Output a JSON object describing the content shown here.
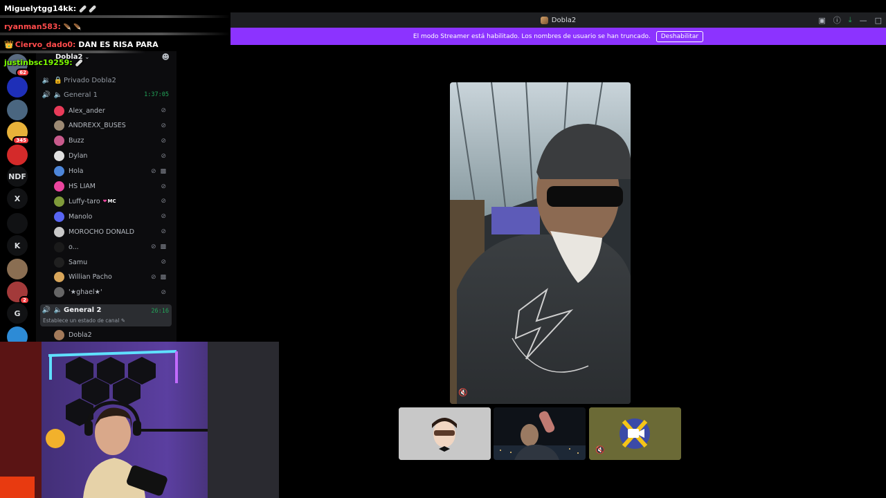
{
  "chat": {
    "lines": [
      {
        "user": "Miguelytgg14kk:",
        "color": "#ffffff",
        "message": "",
        "emotes": "🩹 🩹"
      },
      {
        "user": "ryanman583:",
        "color": "#ff4b4b",
        "message": "",
        "emotes": "🪶 🪶"
      },
      {
        "user": "Ciervo_dado0:",
        "color": "#ff4b4b",
        "message": "DAN ES RISA PARA",
        "emotes": "👑"
      },
      {
        "user": "justinbsc19259:",
        "color": "#7cfc00",
        "message": "",
        "emotes": "🩹"
      }
    ]
  },
  "window": {
    "title": "Dobla2",
    "icons": [
      "inbox-icon",
      "help-icon",
      "download-icon",
      "minimize-icon",
      "maximize-icon"
    ]
  },
  "banner": {
    "text": "El modo Streamer está habilitado. Los nombres de usuario se han truncado.",
    "button": "Deshabilitar"
  },
  "rail": {
    "servers": [
      {
        "label": "",
        "badge": "62",
        "color": "#5a6b80"
      },
      {
        "label": "",
        "badge": "",
        "color": "#1e2fb8"
      },
      {
        "label": "",
        "badge": "",
        "color": "#4a6680"
      },
      {
        "label": "",
        "badge": "345",
        "color": "#e8b23a"
      },
      {
        "label": "",
        "badge": "",
        "color": "#d42a2a"
      },
      {
        "label": "NDF",
        "badge": "",
        "color": "#111214"
      },
      {
        "label": "X",
        "badge": "",
        "color": "#111214"
      },
      {
        "label": "",
        "badge": "",
        "color": "#111214"
      },
      {
        "label": "K",
        "badge": "",
        "color": "#111214"
      },
      {
        "label": "",
        "badge": "",
        "color": "#8a6e52"
      },
      {
        "label": "",
        "badge": "2",
        "color": "#a33a3a"
      },
      {
        "label": "G",
        "badge": "",
        "color": "#111214"
      },
      {
        "label": "",
        "badge": "",
        "color": "#2d8bd6"
      }
    ]
  },
  "server": {
    "name": "Dobla2",
    "private_channel": "Privado Dobla2",
    "voice1": {
      "name": "General 1",
      "time": "1:37:05"
    },
    "voice2": {
      "name": "General 2",
      "time": "26:16",
      "status": "Establece un estado de canal"
    },
    "members1": [
      {
        "name": "Alex_ander",
        "avatar": "#e83b59",
        "video": false
      },
      {
        "name": "ANDREXX_BUSES",
        "avatar": "#9c8a74",
        "video": false
      },
      {
        "name": "Buzz",
        "avatar": "#c85a8c",
        "video": false
      },
      {
        "name": "Dylan",
        "avatar": "#e0e0e0",
        "video": false
      },
      {
        "name": "Hola",
        "avatar": "#4d86d9",
        "video": true
      },
      {
        "name": "HS LIAM",
        "avatar": "#eb459e",
        "video": false
      },
      {
        "name": "Luffy-taro",
        "avatar": "#7f9a3a",
        "video": false,
        "tag": "MC"
      },
      {
        "name": "Manolo",
        "avatar": "#5865f2",
        "video": false
      },
      {
        "name": "MOROCHO DONALD",
        "avatar": "#c9c9c9",
        "video": false
      },
      {
        "name": "o...",
        "avatar": "#1a1a1a",
        "video": true
      },
      {
        "name": "Samu",
        "avatar": "#202020",
        "video": false
      },
      {
        "name": "Willian Pacho",
        "avatar": "#d9a65a",
        "video": true
      },
      {
        "name": "'★ghael★'",
        "avatar": "#666666",
        "video": false
      }
    ],
    "members2": [
      {
        "name": "Dobla2",
        "avatar": "#a27a5a"
      }
    ]
  },
  "colors": {
    "banner": "#8c33ff",
    "voice_green": "#23a55a",
    "titlebar": "#1e1f22"
  }
}
